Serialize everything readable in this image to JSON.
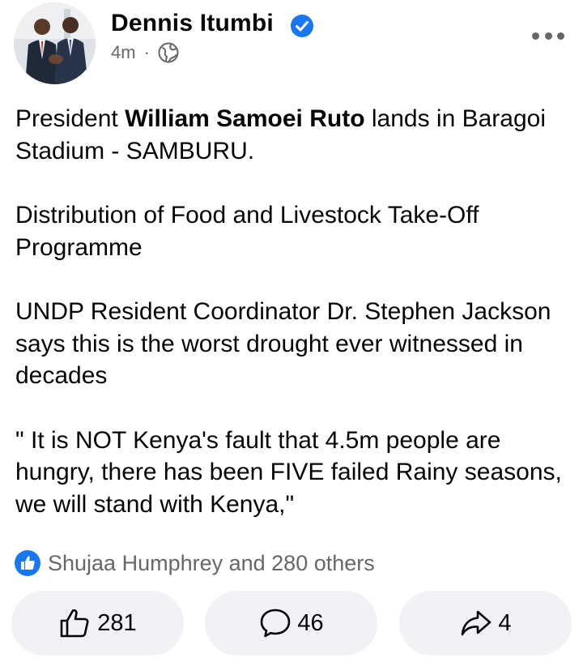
{
  "post": {
    "author": "Dennis Itumbi",
    "time": "4m",
    "separator": "·",
    "paragraphs": [
      {
        "before": "President ",
        "bold": "William Samoei Ruto",
        "after": " lands in Baragoi Stadium - SAMBURU."
      },
      {
        "text": "Distribution of Food and Livestock Take-Off Programme"
      },
      {
        "text": "UNDP Resident Coordinator Dr. Stephen Jackson says this is the worst drought ever witnessed in decades"
      },
      {
        "text": "\" It is NOT Kenya's fault that 4.5m people are hungry, there has been FIVE failed Rainy seasons, we will stand with Kenya,\""
      }
    ]
  },
  "reactions": {
    "summary": "Shujaa Humphrey and 280 others"
  },
  "actions": {
    "like_count": "281",
    "comment_count": "46",
    "share_count": "4"
  },
  "colors": {
    "verified": "#1877f2",
    "secondary_text": "#65676b",
    "pill_bg": "#f0f2f5"
  },
  "icons": [
    "avatar-photo",
    "verified-badge-icon",
    "globe-icon",
    "more-options-icon",
    "like-reaction-icon",
    "thumbs-up-icon",
    "comment-icon",
    "share-icon"
  ]
}
